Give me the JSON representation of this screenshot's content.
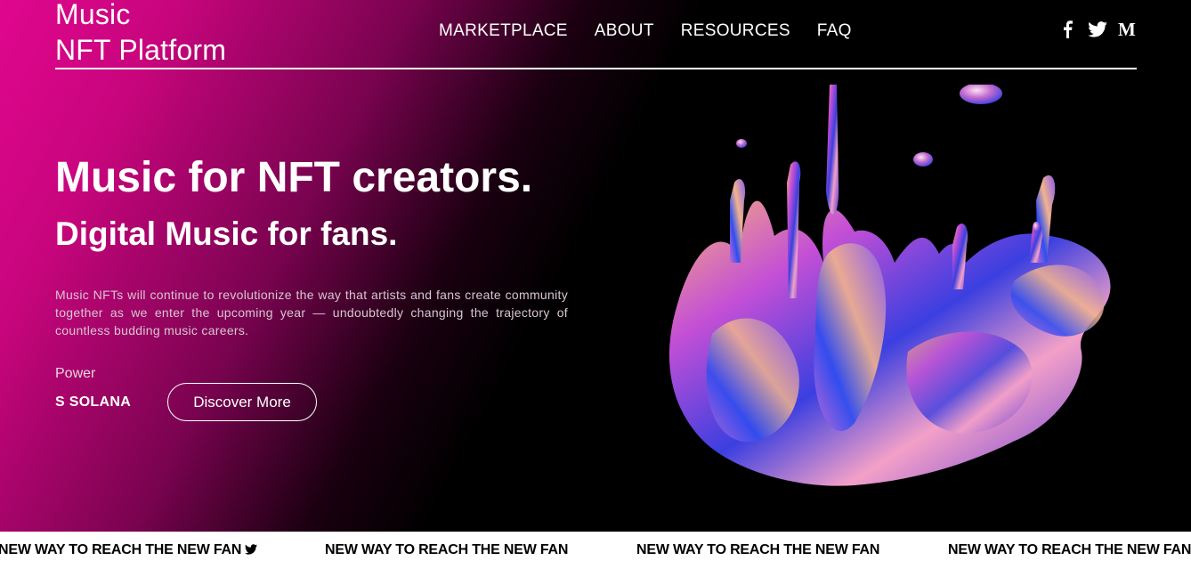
{
  "header": {
    "brand_line1": "Music",
    "brand_line2": "NFT Platform",
    "nav": [
      {
        "label": "MARKETPLACE"
      },
      {
        "label": "ABOUT"
      },
      {
        "label": "RESOURCES"
      },
      {
        "label": "FAQ"
      }
    ],
    "social_icons": [
      "facebook-icon",
      "twitter-icon",
      "medium-icon"
    ]
  },
  "hero": {
    "title": "Music for NFT creators.",
    "subtitle": "Digital Music for fans.",
    "description": "Music NFTs will continue to revolutionize the way that artists and fans create community together as we enter the upcoming year — undoubtedly changing the trajectory of countless budding music careers.",
    "power_label": "Power",
    "power_brand": "S SOLANA",
    "cta_label": "Discover More"
  },
  "ticker": {
    "items": [
      "NEW WAY TO REACH THE NEW FAN",
      "NEW WAY TO REACH THE NEW FAN",
      "NEW WAY TO REACH THE NEW FAN",
      "NEW WAY TO REACH THE NEW FAN"
    ]
  },
  "colors": {
    "accent_pink": "#e0068e",
    "background": "#000000",
    "ticker_bg": "#ffffff"
  }
}
